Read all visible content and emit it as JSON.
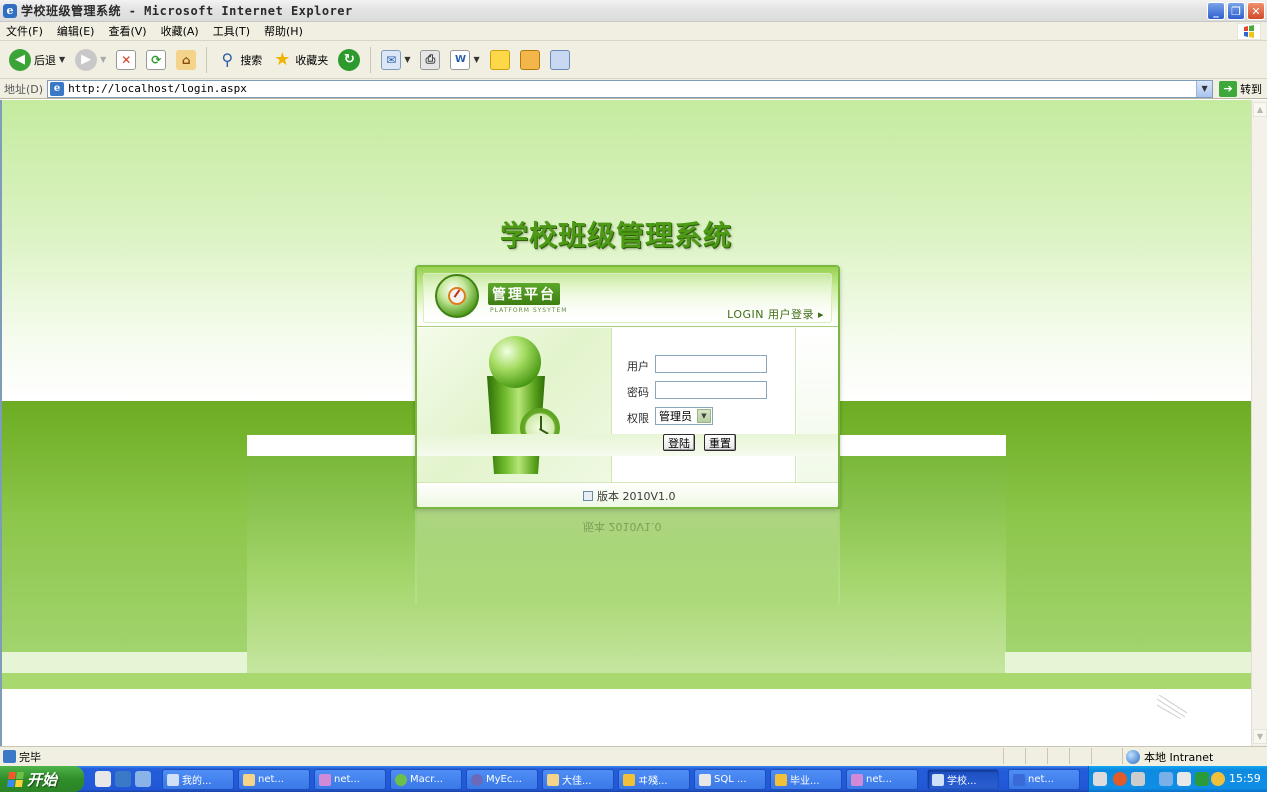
{
  "window": {
    "title": "学校班级管理系统 - Microsoft Internet Explorer",
    "icon": "ie-icon",
    "buttons": [
      "minimize",
      "maximize",
      "close"
    ]
  },
  "menubar": {
    "items": [
      "文件(F)",
      "编辑(E)",
      "查看(V)",
      "收藏(A)",
      "工具(T)",
      "帮助(H)"
    ]
  },
  "toolbar": {
    "back_label": "后退",
    "search_label": "搜索",
    "favorites_label": "收藏夹"
  },
  "address": {
    "label": "地址(D)",
    "url": "http://localhost/login.aspx",
    "go_label": "转到"
  },
  "page": {
    "title": "学校班级管理系统",
    "platform_title": "管理平台",
    "platform_subtitle": "PLATFORM SYSYTEM",
    "login_caption": "LOGIN 用户登录 ▸",
    "form": {
      "user_label": "用户",
      "user_value": "",
      "password_label": "密码",
      "password_value": "",
      "role_label": "权限",
      "role_selected": "管理员",
      "login_button": "登陆",
      "reset_button": "重置"
    },
    "version": "版本 2010V1.0",
    "reflection_version": "版本 2010V1.0",
    "colors": {
      "accent": "#5da82a",
      "band": "#8cc64a"
    }
  },
  "statusbar": {
    "status": "完毕",
    "zone": "本地 Intranet"
  },
  "taskbar": {
    "start_label": "开始",
    "tasks": [
      {
        "label": "我的...",
        "icon": "ie-icon"
      },
      {
        "label": "net...",
        "icon": "folder-icon"
      },
      {
        "label": "net...",
        "icon": "vs-icon"
      },
      {
        "label": "Macr...",
        "icon": "macromedia-icon"
      },
      {
        "label": "MyEc...",
        "icon": "myeclipse-icon"
      },
      {
        "label": "大佳...",
        "icon": "folder-icon"
      },
      {
        "label": "ヰ殘...",
        "icon": "app-icon"
      },
      {
        "label": "SQL ...",
        "icon": "sql-icon"
      },
      {
        "label": "毕业...",
        "icon": "app-icon"
      },
      {
        "label": "net...",
        "icon": "vs-icon"
      },
      {
        "label": "学校...",
        "icon": "ie-icon"
      },
      {
        "label": "net...",
        "icon": "word-icon"
      }
    ],
    "clock": "15:59"
  }
}
